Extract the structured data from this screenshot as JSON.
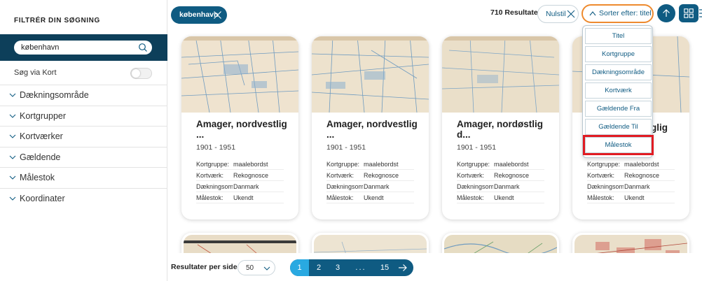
{
  "colors": {
    "brand": "#0f5b82",
    "search_band": "#0d3f5a",
    "sort_outline": "#ee8a2e",
    "highlight_box": "#e11b22",
    "active_page": "#29a9e1"
  },
  "sidebar": {
    "title": "FILTRÉR DIN SØGNING",
    "search": {
      "value": "københavn",
      "placeholder": "",
      "icon": "search-icon"
    },
    "map_toggle": {
      "label": "Søg via Kort",
      "on": false
    },
    "facets": [
      {
        "label": "Dækningsområde"
      },
      {
        "label": "Kortgrupper"
      },
      {
        "label": "Kortværker"
      },
      {
        "label": "Gældende"
      },
      {
        "label": "Målestok"
      },
      {
        "label": "Koordinater"
      }
    ]
  },
  "toolbar": {
    "chip_label": "københavn",
    "results": "710 Resultater",
    "reset_label": "Nulstil",
    "sort_label": "Sorter efter: titel"
  },
  "sort_menu": {
    "options": [
      {
        "label": "Titel"
      },
      {
        "label": "Kortgruppe"
      },
      {
        "label": "Dækningsområde"
      },
      {
        "label": "Kortværk"
      },
      {
        "label": "Gældende Fra"
      },
      {
        "label": "Gældende Til"
      },
      {
        "label": "Målestok"
      }
    ],
    "highlighted": "Målestok"
  },
  "cards": [
    {
      "title": "Amager, nordvestlig ...",
      "years": "1901 - 1951",
      "meta": [
        {
          "k": "Kortgruppe:",
          "v": "maalebordst"
        },
        {
          "k": "Kortværk:",
          "v": "Rekognosce"
        },
        {
          "k": "Dækningsom",
          "v": "Danmark"
        },
        {
          "k": "Målestok:",
          "v": "Ukendt"
        }
      ]
    },
    {
      "title": "Amager, nordvestlig ...",
      "years": "1901 - 1951",
      "meta": [
        {
          "k": "Kortgruppe:",
          "v": "maalebordst"
        },
        {
          "k": "Kortværk:",
          "v": "Rekognosce"
        },
        {
          "k": "Dækningsom",
          "v": "Danmark"
        },
        {
          "k": "Målestok:",
          "v": "Ukendt"
        }
      ]
    },
    {
      "title": "Amager, nordøstlig d...",
      "years": "1901 - 1951",
      "meta": [
        {
          "k": "Kortgruppe:",
          "v": "maalebordst"
        },
        {
          "k": "Kortværk:",
          "v": "Rekognosce"
        },
        {
          "k": "Dækningsom",
          "v": "Danmark"
        },
        {
          "k": "Målestok:",
          "v": "Ukendt"
        }
      ]
    },
    {
      "title": "glig",
      "years": "",
      "meta": [
        {
          "k": "Kortgruppe:",
          "v": "maalebordst"
        },
        {
          "k": "Kortværk:",
          "v": "Rekognosce"
        },
        {
          "k": "Dækningsom",
          "v": "Danmark"
        },
        {
          "k": "Målestok:",
          "v": "Ukendt"
        }
      ]
    }
  ],
  "pagination": {
    "per_page_label": "Resultater per side",
    "per_page_value": "50",
    "pages": [
      "1",
      "2",
      "3",
      "...",
      "15"
    ],
    "current": "1"
  }
}
